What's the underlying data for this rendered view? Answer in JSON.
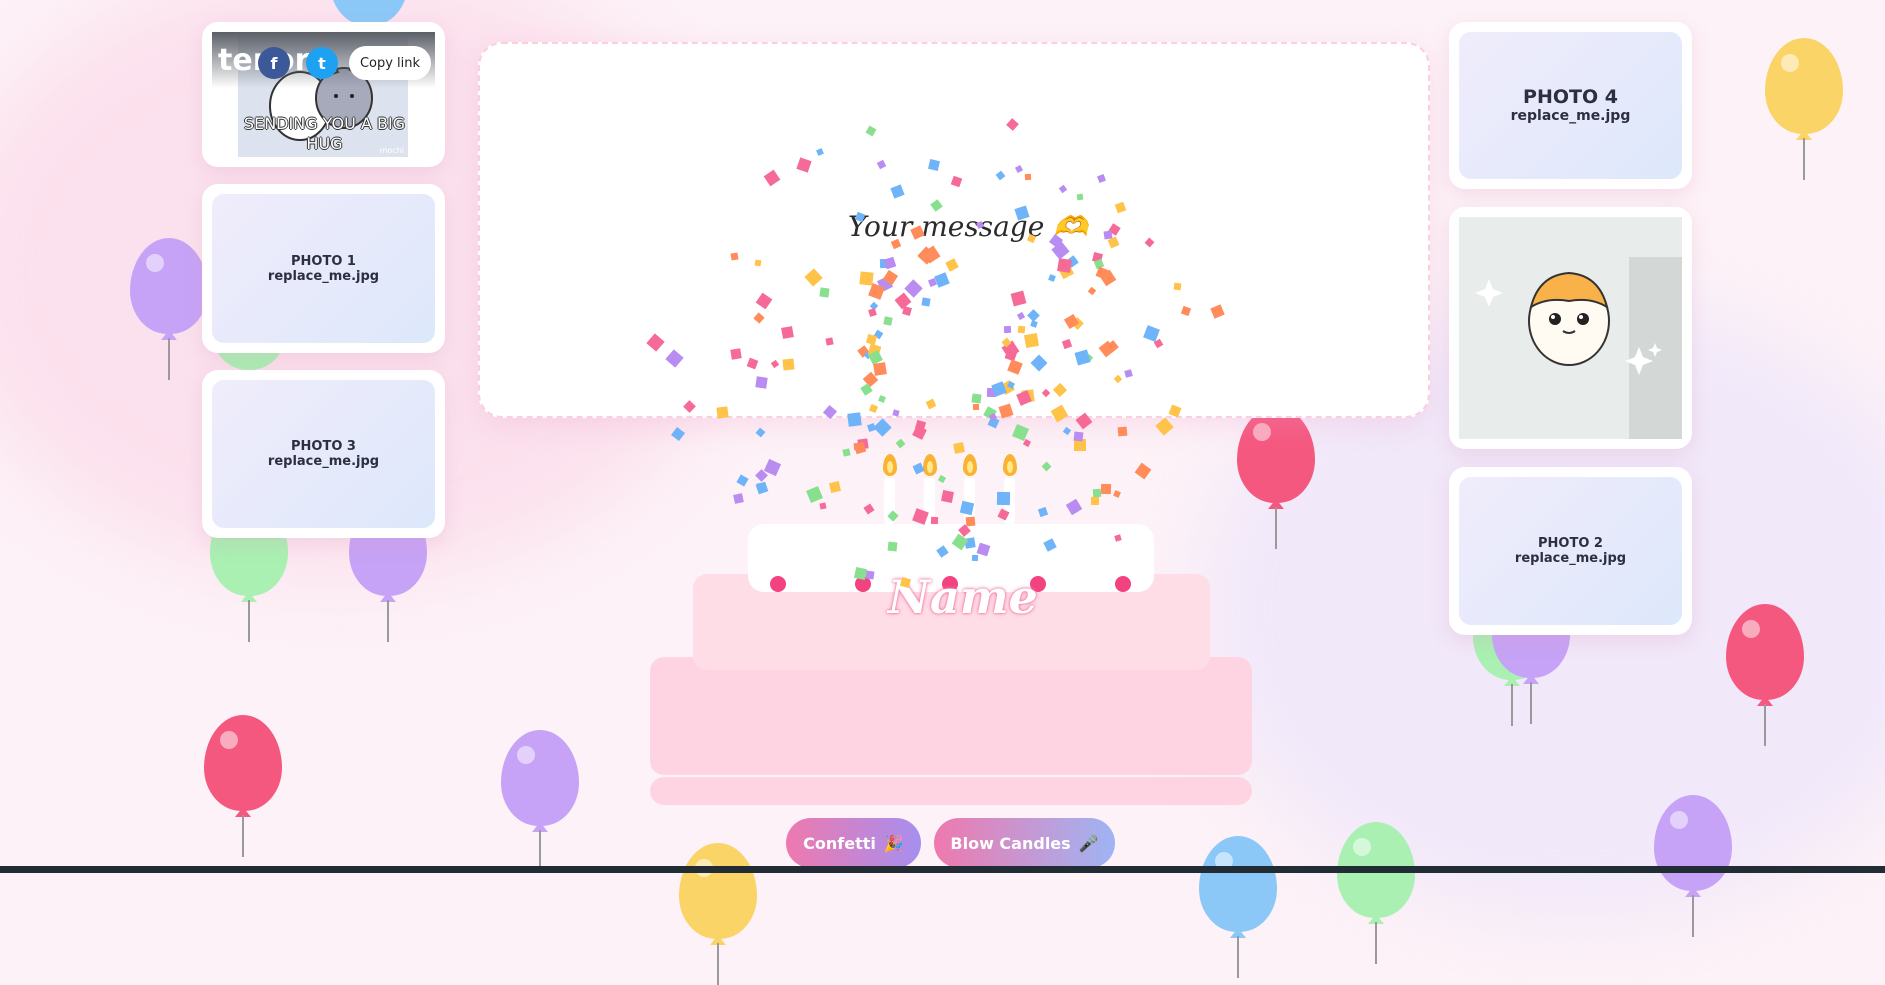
{
  "gif": {
    "brand": "tenor",
    "caption": "SENDING YOU A BIG HUG",
    "watermark": "mochi",
    "share_facebook": "f",
    "share_twitter": "t",
    "copy_link": "Copy link"
  },
  "photos": [
    {
      "title": "PHOTO 1",
      "file": "replace_me.jpg"
    },
    {
      "title": "PHOTO 3",
      "file": "replace_me.jpg"
    },
    {
      "title": "PHOTO 4",
      "file": "replace_me.jpg"
    },
    {
      "title": "PHOTO 2",
      "file": "replace_me.jpg"
    }
  ],
  "message": {
    "text": "Your message",
    "emoji": "🫶"
  },
  "cake": {
    "name": "Name",
    "candles": 4
  },
  "buttons": {
    "confetti": "Confetti",
    "confetti_icon": "🎉",
    "blow": "Blow Candles",
    "blow_icon": "🎤"
  },
  "colors": {
    "accent_pink": "#ee79ae",
    "accent_purple": "#a68ff0",
    "accent_blue": "#9fb4f4",
    "cherry": "#f2427f",
    "background": "#fdf2f7"
  }
}
